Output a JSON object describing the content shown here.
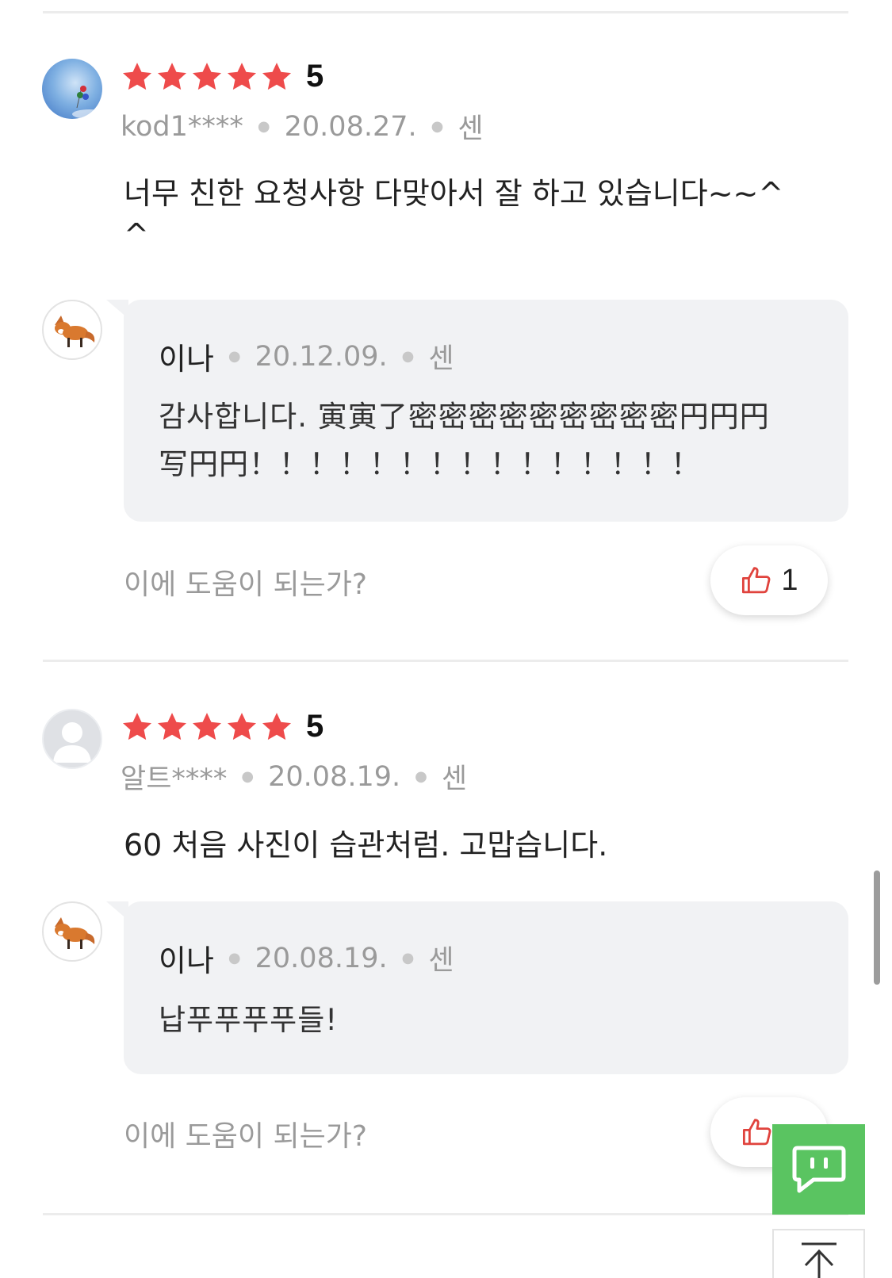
{
  "colors": {
    "star": "#ee4b4b",
    "like_icon": "#e0433d",
    "fab": "#5ac461"
  },
  "reviews": [
    {
      "rating": "5",
      "user": "kod1****",
      "date": "20.08.27.",
      "platform": "센",
      "text": "너무 친한 요청사항 다맞아서 잘 하고 있습니다~~^\n^",
      "reply": {
        "name": "이나",
        "date": "20.12.09.",
        "platform": "센",
        "text": "감사합니다. 寅寅了密密密密密密密密密円円円\n写円円！！！！！！！！！！！！！！！"
      },
      "helpful_label": "이에 도움이 되는가?",
      "like_count": "1"
    },
    {
      "rating": "5",
      "user": "알트****",
      "date": "20.08.19.",
      "platform": "센",
      "text": "60 처음 사진이 습관처럼. 고맙습니다.",
      "reply": {
        "name": "이나",
        "date": "20.08.19.",
        "platform": "센",
        "text": "납푸푸푸푸들!"
      },
      "helpful_label": "이에 도움이 되는가?"
    }
  ],
  "icons": {
    "star": "star-icon",
    "like": "thumbs-up-icon",
    "chat": "chat-bubble-icon",
    "top": "arrow-up-to-top-icon"
  }
}
